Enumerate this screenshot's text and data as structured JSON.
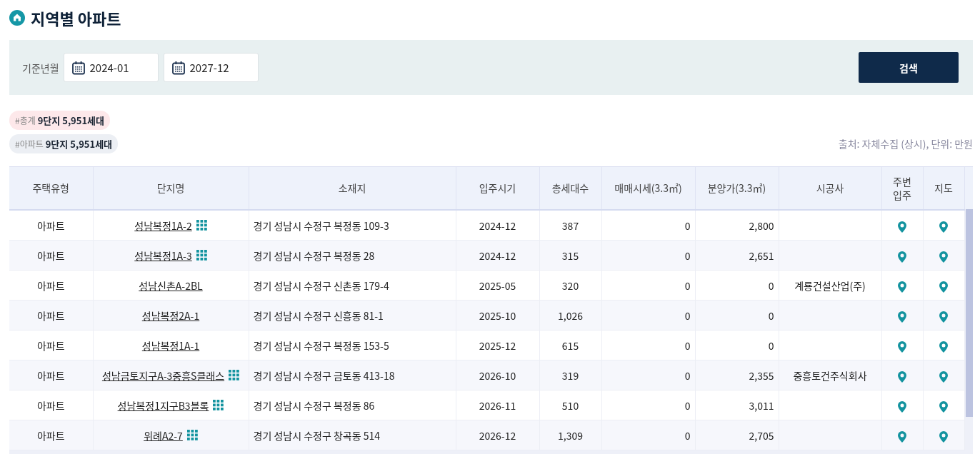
{
  "page_title": "지역별 아파트",
  "filter": {
    "label": "기준년월",
    "start": "2024-01",
    "end": "2027-12",
    "search_button": "검색"
  },
  "summary_tags": [
    {
      "kind": "total",
      "tag": "#총계",
      "value": "9단지 5,951세대"
    },
    {
      "kind": "apartment",
      "tag": "#아파트",
      "value": "9단지 5,951세대"
    }
  ],
  "source_note": "출처: 자체수집 (상시), 단위: 만원",
  "table": {
    "columns": [
      "주택유형",
      "단지명",
      "소재지",
      "입주시기",
      "총세대수",
      "매매시세(3.3㎡)",
      "분양가(3.3㎡)",
      "시공사",
      "주변\n입주",
      "지도"
    ],
    "rows": [
      {
        "type": "아파트",
        "name": "성남복정1A-2",
        "units_icon": true,
        "address": "경기 성남시 수정구 복정동 109-3",
        "move_in": "2024-12",
        "households": "387",
        "sale_price": "0",
        "presale_price": "2,800",
        "builder": ""
      },
      {
        "type": "아파트",
        "name": "성남복정1A-3",
        "units_icon": true,
        "address": "경기 성남시 수정구 복정동 28",
        "move_in": "2024-12",
        "households": "315",
        "sale_price": "0",
        "presale_price": "2,651",
        "builder": ""
      },
      {
        "type": "아파트",
        "name": "성남신촌A-2BL",
        "units_icon": false,
        "address": "경기 성남시 수정구 신촌동 179-4",
        "move_in": "2025-05",
        "households": "320",
        "sale_price": "0",
        "presale_price": "0",
        "builder": "계룡건설산업(주)"
      },
      {
        "type": "아파트",
        "name": "성남복정2A-1",
        "units_icon": false,
        "address": "경기 성남시 수정구 신흥동 81-1",
        "move_in": "2025-10",
        "households": "1,026",
        "sale_price": "0",
        "presale_price": "0",
        "builder": ""
      },
      {
        "type": "아파트",
        "name": "성남복정1A-1",
        "units_icon": false,
        "address": "경기 성남시 수정구 복정동 153-5",
        "move_in": "2025-12",
        "households": "615",
        "sale_price": "0",
        "presale_price": "0",
        "builder": ""
      },
      {
        "type": "아파트",
        "name": "성남금토지구A-3중흥S클래스",
        "units_icon": true,
        "address": "경기 성남시 수정구 금토동 413-18",
        "move_in": "2026-10",
        "households": "319",
        "sale_price": "0",
        "presale_price": "2,355",
        "builder": "중흥토건주식회사"
      },
      {
        "type": "아파트",
        "name": "성남복정1지구B3블록",
        "units_icon": true,
        "address": "경기 성남시 수정구 복정동 86",
        "move_in": "2026-11",
        "households": "510",
        "sale_price": "0",
        "presale_price": "3,011",
        "builder": ""
      },
      {
        "type": "아파트",
        "name": "위례A2-7",
        "units_icon": true,
        "address": "경기 성남시 수정구 창곡동 514",
        "move_in": "2026-12",
        "households": "1,309",
        "sale_price": "0",
        "presale_price": "2,705",
        "builder": ""
      }
    ]
  }
}
